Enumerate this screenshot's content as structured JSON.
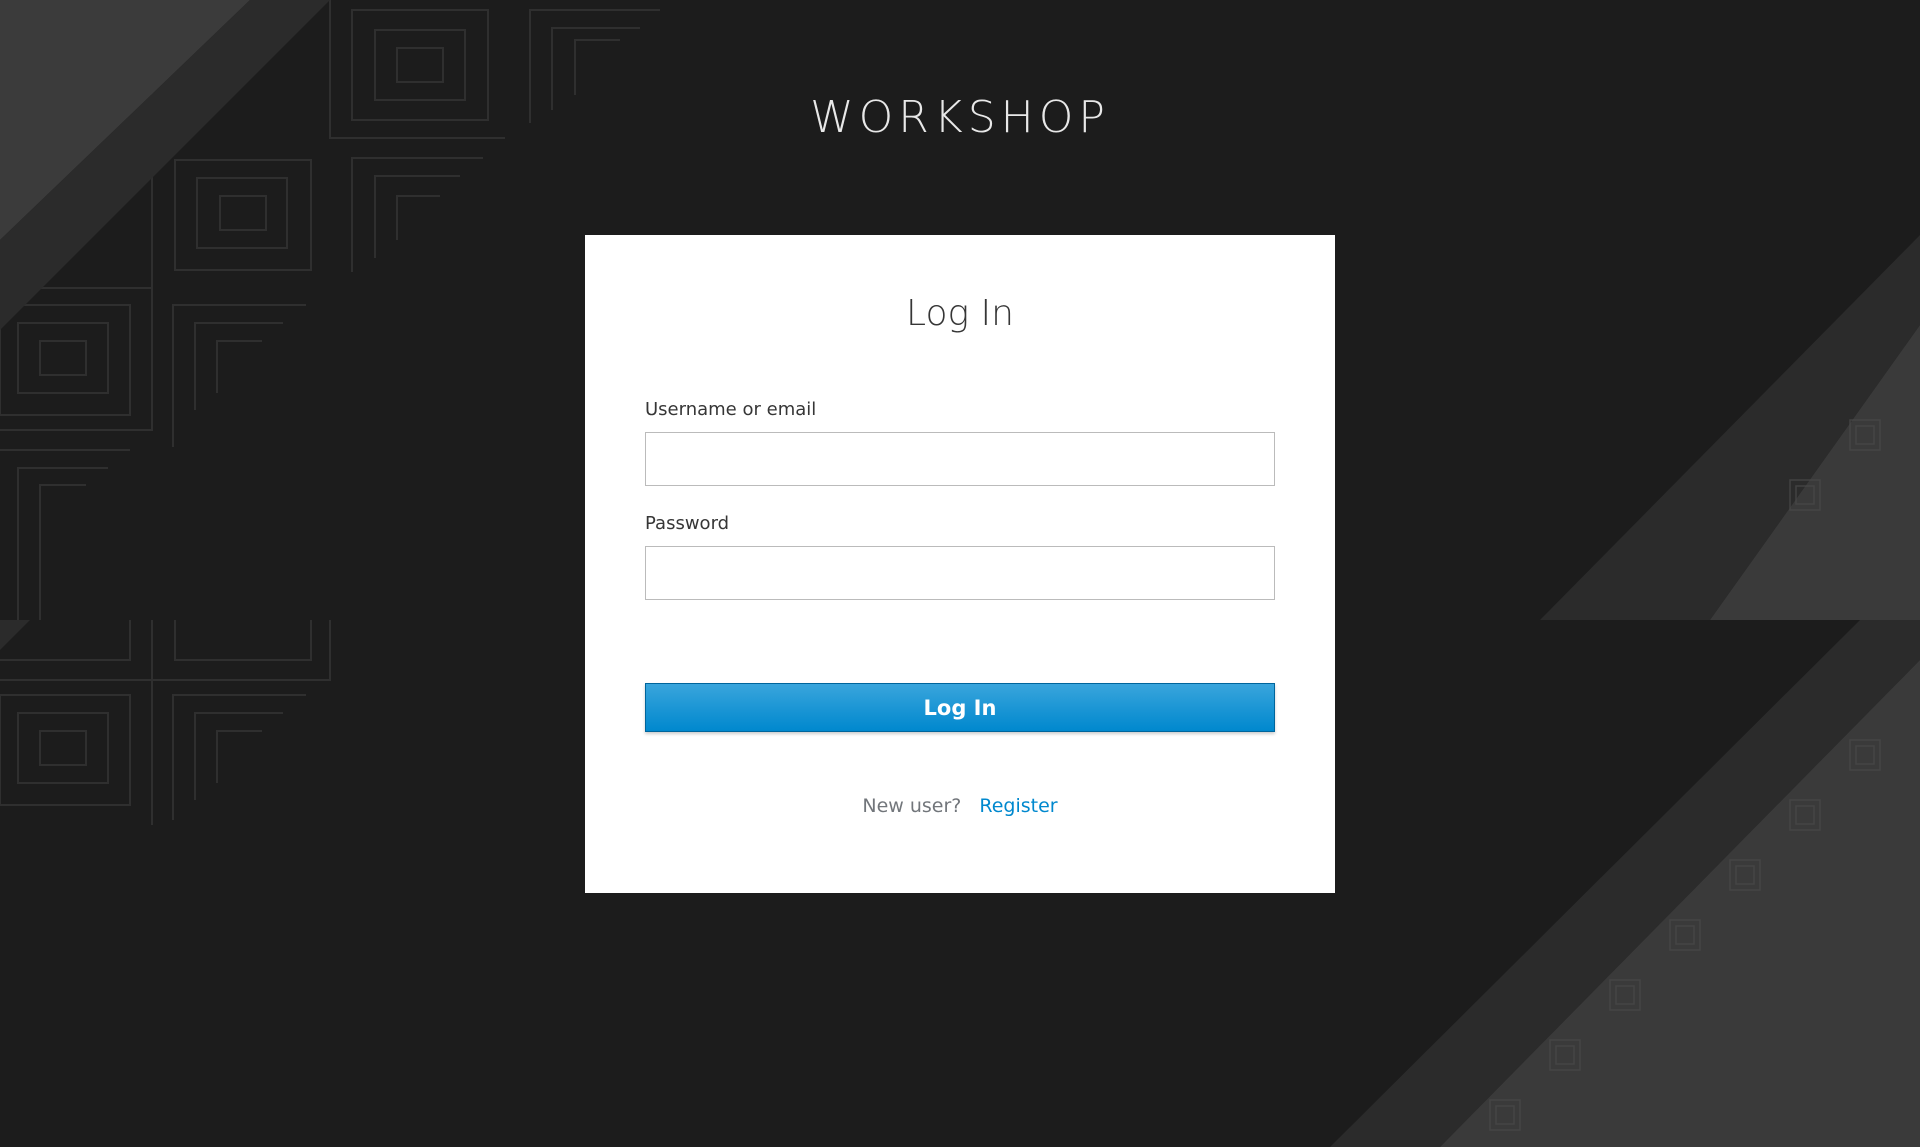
{
  "brand": {
    "title": "WORKSHOP"
  },
  "login": {
    "heading": "Log In",
    "username_label": "Username or email",
    "username_value": "",
    "password_label": "Password",
    "password_value": "",
    "submit_label": "Log In",
    "new_user_text": "New user?",
    "register_link": "Register"
  },
  "colors": {
    "background": "#1c1c1c",
    "accent": "#0088ce",
    "card": "#ffffff"
  }
}
